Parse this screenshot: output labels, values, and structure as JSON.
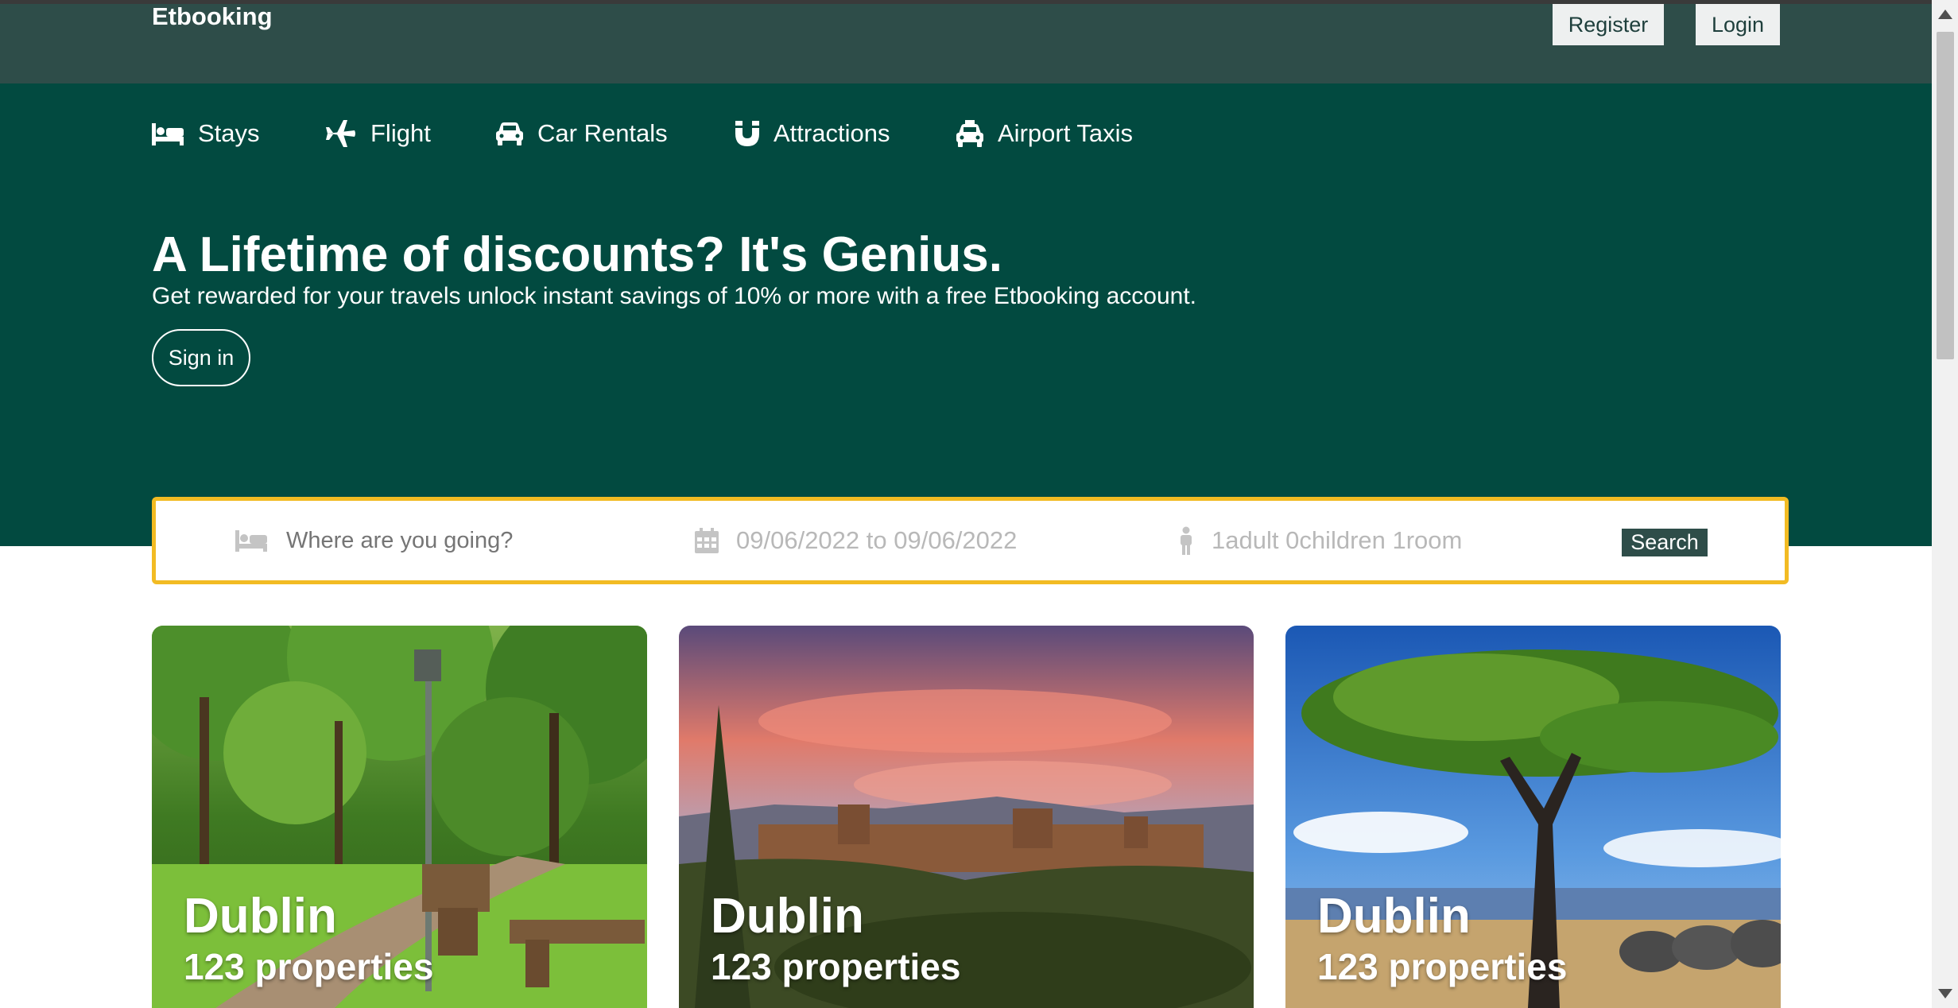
{
  "header": {
    "brand": "Etbooking",
    "register_label": "Register",
    "login_label": "Login"
  },
  "nav": {
    "items": [
      {
        "label": "Stays",
        "icon": "bed-icon"
      },
      {
        "label": "Flight",
        "icon": "plane-icon"
      },
      {
        "label": "Car Rentals",
        "icon": "car-icon"
      },
      {
        "label": "Attractions",
        "icon": "magnet-icon"
      },
      {
        "label": "Airport Taxis",
        "icon": "taxi-icon"
      }
    ]
  },
  "hero": {
    "title": "A Lifetime of discounts? It's Genius.",
    "subtitle": "Get rewarded for your travels unlock instant savings of 10% or more with a free Etbooking account.",
    "signin_label": "Sign in"
  },
  "search": {
    "destination_placeholder": "Where are you going?",
    "dates": "09/06/2022 to 09/06/2022",
    "guests": "1adult 0children 1room",
    "button_label": "Search"
  },
  "cards": [
    {
      "city": "Dublin",
      "properties": "123 properties",
      "image": "park-image"
    },
    {
      "city": "Dublin",
      "properties": "123 properties",
      "image": "castle-sunset-image"
    },
    {
      "city": "Dublin",
      "properties": "123 properties",
      "image": "acacia-savanna-image"
    }
  ],
  "colors": {
    "topbar": "#2e4d49",
    "hero": "#024a40",
    "search_border": "#f2bb23",
    "button_dark": "#2e4d49"
  }
}
